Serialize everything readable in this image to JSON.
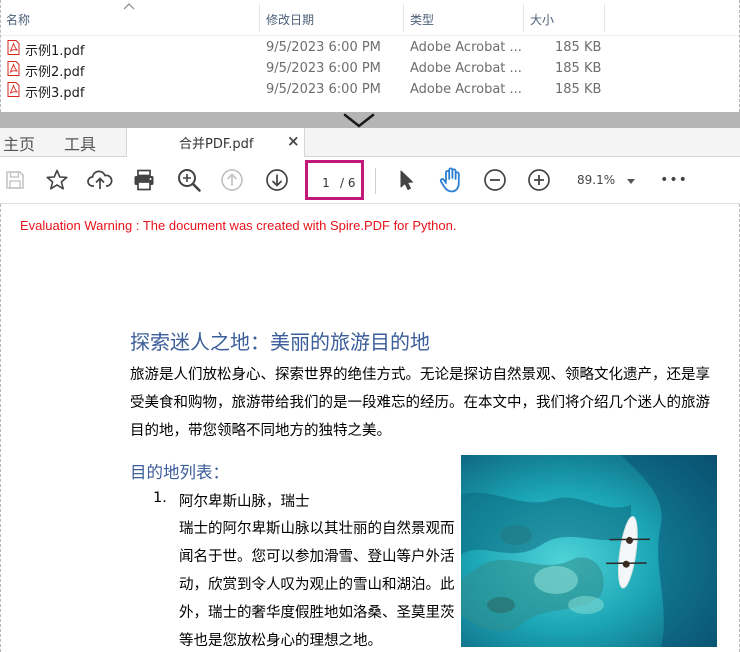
{
  "explorer": {
    "columns": {
      "name": "名称",
      "date": "修改日期",
      "type": "类型",
      "size": "大小"
    },
    "files": [
      {
        "name": "示例1.pdf",
        "date": "9/5/2023 6:00 PM",
        "type": "Adobe Acrobat ...",
        "size": "185 KB"
      },
      {
        "name": "示例2.pdf",
        "date": "9/5/2023 6:00 PM",
        "type": "Adobe Acrobat ...",
        "size": "185 KB"
      },
      {
        "name": "示例3.pdf",
        "date": "9/5/2023 6:00 PM",
        "type": "Adobe Acrobat ...",
        "size": "185 KB"
      }
    ]
  },
  "tabs": {
    "home": "主页",
    "tools": "工具",
    "document": "合并PDF.pdf",
    "close": "×"
  },
  "toolbar": {
    "page_current": "1",
    "page_total": "/ 6",
    "zoom": "89.1%",
    "more": "•••"
  },
  "document": {
    "warning": "Evaluation Warning : The document was created with Spire.PDF for Python.",
    "title": "探索迷人之地：美丽的旅游目的地",
    "intro": "旅游是人们放松身心、探索世界的绝佳方式。无论是探访自然景观、领略文化遗产，还是享受美食和购物，旅游带给我们的是一段难忘的经历。在本文中，我们将介绍几个迷人的旅游目的地，带您领略不同地方的独特之美。",
    "section_heading": "目的地列表：",
    "list": [
      {
        "number": "1.",
        "title": "阿尔卑斯山脉，瑞士",
        "description": "瑞士的阿尔卑斯山脉以其壮丽的自然景观而闻名于世。您可以参加滑雪、登山等户外活动，欣赏到令人叹为观止的雪山和湖泊。此外，瑞士的奢华度假胜地如洛桑、圣莫里茨等也是您放松身心的理想之地。"
      }
    ]
  },
  "colors": {
    "accent_heading": "#3b5d9a",
    "warning": "#e8121a",
    "page_box_border": "#c2187a",
    "hand_tool": "#2b7fd4"
  },
  "icons": [
    "pdf-file-icon",
    "save-icon",
    "star-icon",
    "cloud-upload-icon",
    "print-icon",
    "search-zoom-icon",
    "page-up-icon",
    "page-down-icon",
    "select-cursor-icon",
    "hand-tool-icon",
    "zoom-out-icon",
    "zoom-in-icon",
    "more-icon",
    "chevron-down-icon"
  ]
}
